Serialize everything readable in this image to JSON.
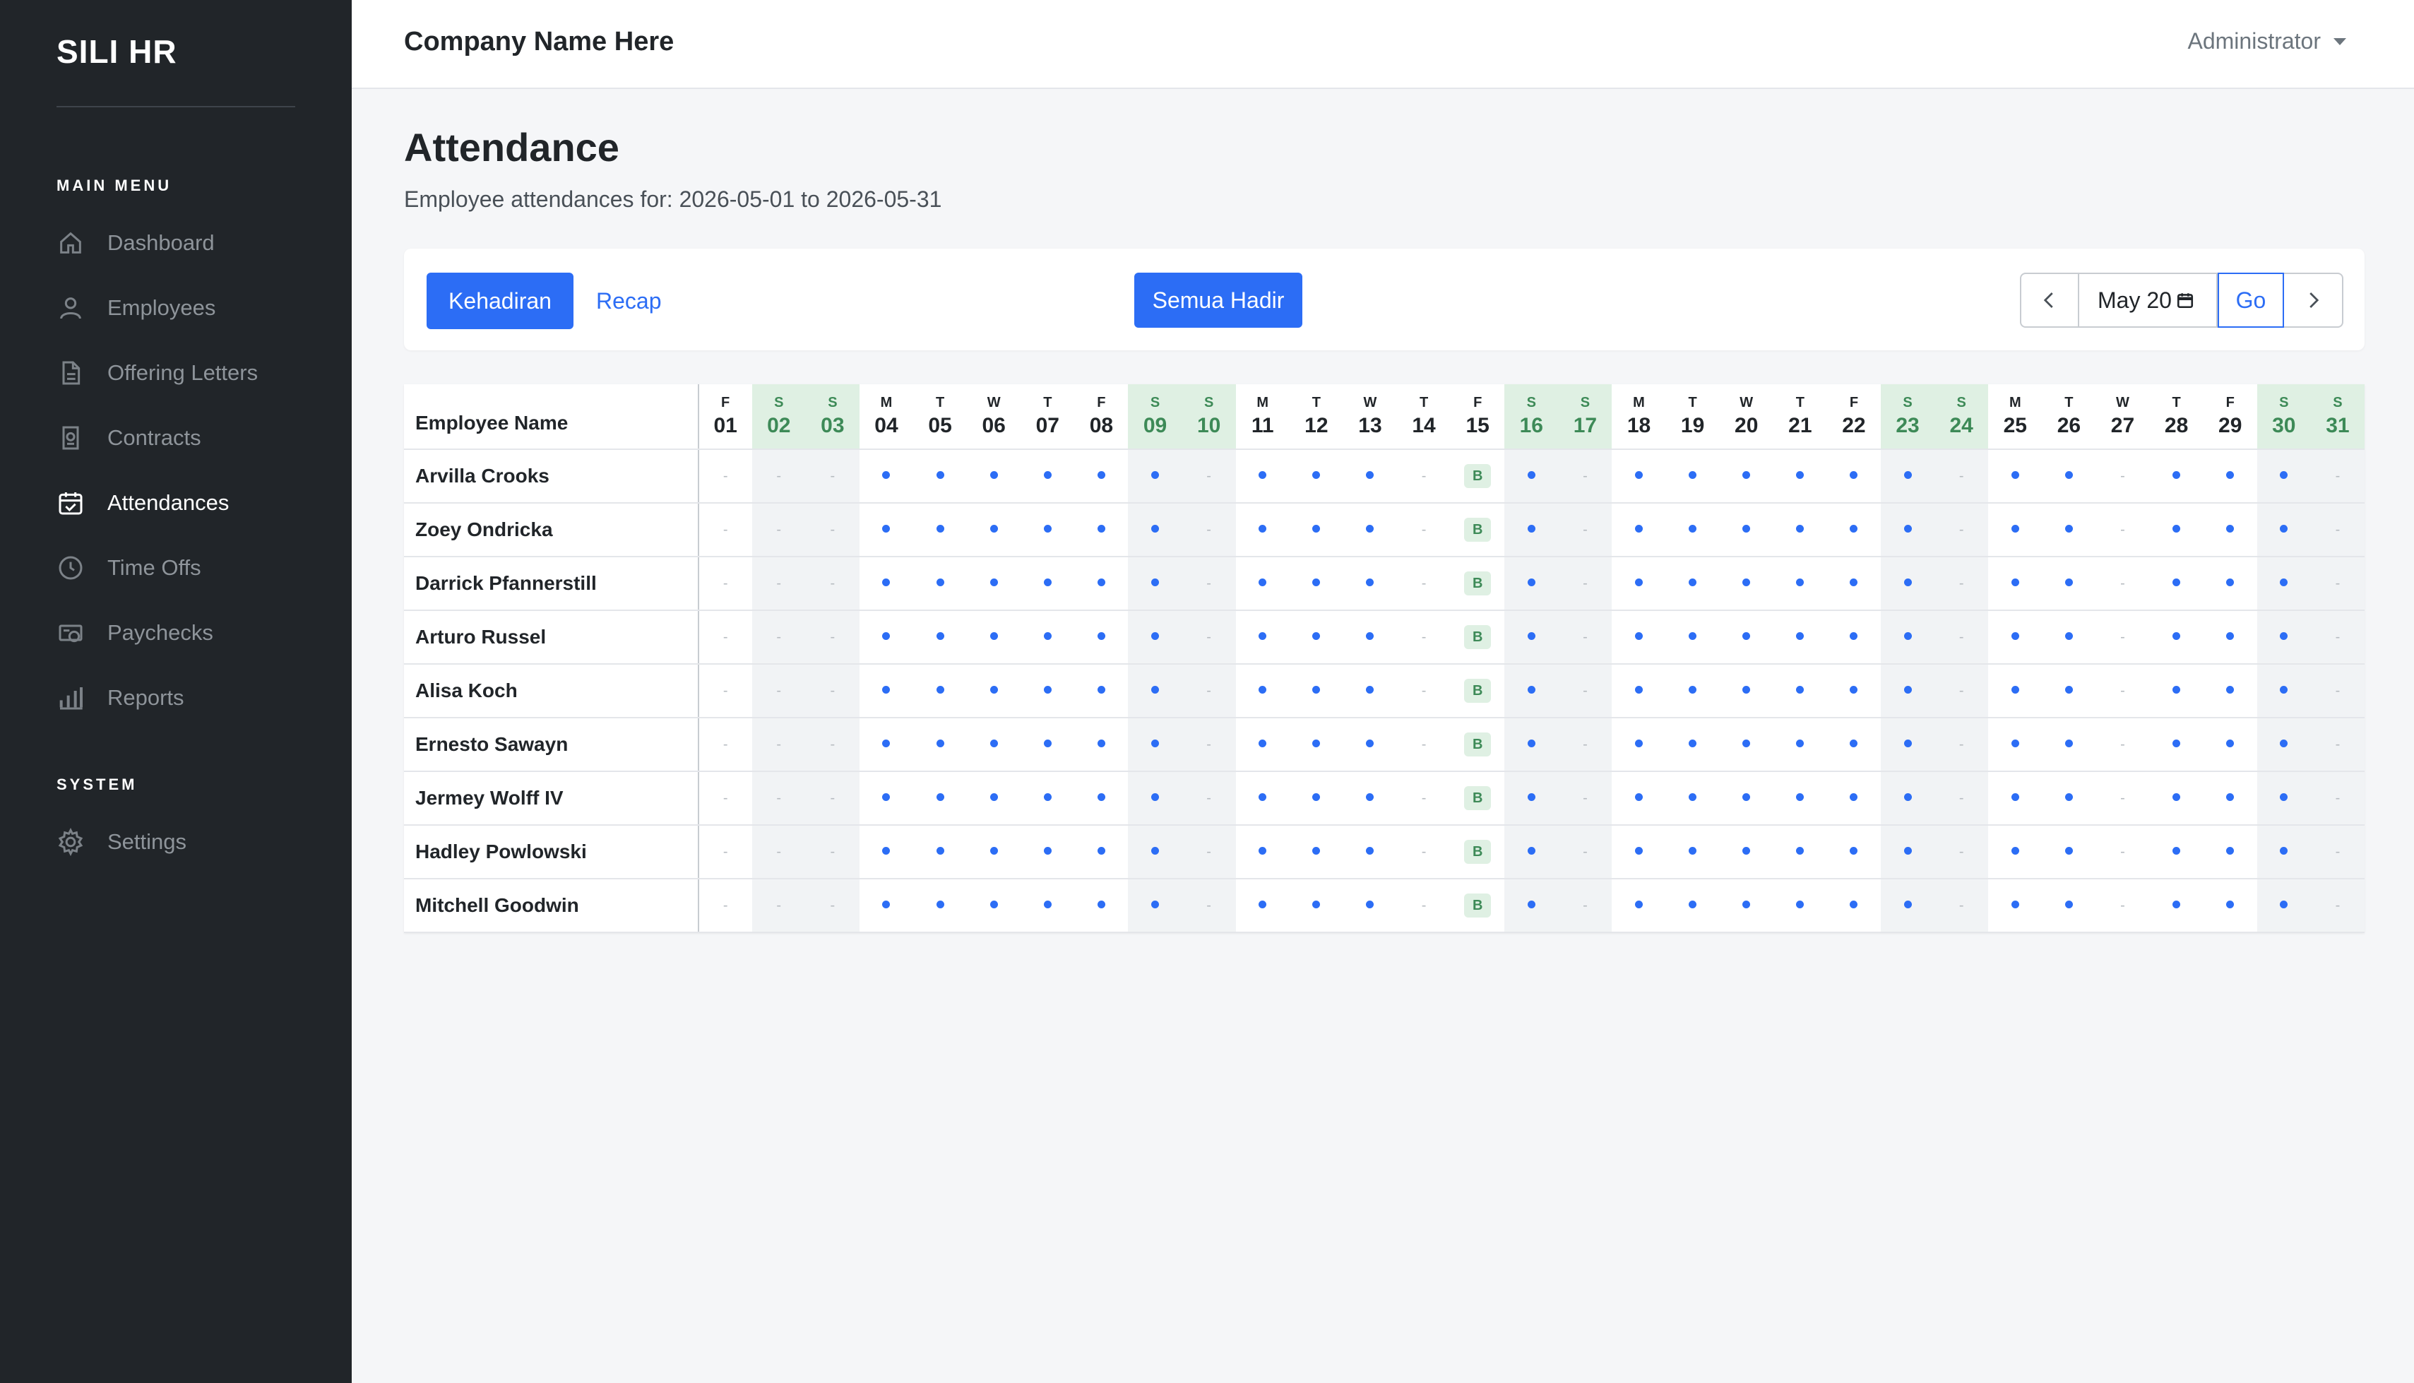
{
  "app": {
    "brand": "SILI HR",
    "company": "Company Name Here",
    "user": "Administrator"
  },
  "sidebar": {
    "main_heading": "MAIN MENU",
    "system_heading": "SYSTEM",
    "items": [
      {
        "label": "Dashboard",
        "icon": "home-icon"
      },
      {
        "label": "Employees",
        "icon": "person-icon"
      },
      {
        "label": "Offering Letters",
        "icon": "document-icon"
      },
      {
        "label": "Contracts",
        "icon": "contract-icon"
      },
      {
        "label": "Attendances",
        "icon": "calendar-check-icon",
        "active": true
      },
      {
        "label": "Time Offs",
        "icon": "clock-icon"
      },
      {
        "label": "Paychecks",
        "icon": "paycheck-icon"
      },
      {
        "label": "Reports",
        "icon": "bar-chart-icon"
      }
    ],
    "system_items": [
      {
        "label": "Settings",
        "icon": "gear-icon"
      }
    ]
  },
  "page": {
    "title": "Attendance",
    "subtitle": "Employee attendances for: 2026-05-01 to 2026-05-31"
  },
  "toolbar": {
    "kehadiran_label": "Kehadiran",
    "recap_label": "Recap",
    "semua_hadir_label": "Semua Hadir",
    "month_value": "May 20",
    "go_label": "Go"
  },
  "table": {
    "employee_header": "Employee Name",
    "days": [
      {
        "dow": "F",
        "num": "01"
      },
      {
        "dow": "S",
        "num": "02"
      },
      {
        "dow": "S",
        "num": "03"
      },
      {
        "dow": "M",
        "num": "04"
      },
      {
        "dow": "T",
        "num": "05"
      },
      {
        "dow": "W",
        "num": "06"
      },
      {
        "dow": "T",
        "num": "07"
      },
      {
        "dow": "F",
        "num": "08"
      },
      {
        "dow": "S",
        "num": "09"
      },
      {
        "dow": "S",
        "num": "10"
      },
      {
        "dow": "M",
        "num": "11"
      },
      {
        "dow": "T",
        "num": "12"
      },
      {
        "dow": "W",
        "num": "13"
      },
      {
        "dow": "T",
        "num": "14"
      },
      {
        "dow": "F",
        "num": "15"
      },
      {
        "dow": "S",
        "num": "16"
      },
      {
        "dow": "S",
        "num": "17"
      },
      {
        "dow": "M",
        "num": "18"
      },
      {
        "dow": "T",
        "num": "19"
      },
      {
        "dow": "W",
        "num": "20"
      },
      {
        "dow": "T",
        "num": "21"
      },
      {
        "dow": "F",
        "num": "22"
      },
      {
        "dow": "S",
        "num": "23"
      },
      {
        "dow": "S",
        "num": "24"
      },
      {
        "dow": "M",
        "num": "25"
      },
      {
        "dow": "T",
        "num": "26"
      },
      {
        "dow": "W",
        "num": "27"
      },
      {
        "dow": "T",
        "num": "28"
      },
      {
        "dow": "F",
        "num": "29"
      },
      {
        "dow": "S",
        "num": "30"
      },
      {
        "dow": "S",
        "num": "31"
      }
    ],
    "attendance": [
      "-",
      "-",
      "-",
      "•",
      "•",
      "•",
      "•",
      "•",
      "•",
      "-",
      "•",
      "•",
      "•",
      "-",
      "B",
      "•",
      "-",
      "•",
      "•",
      "•",
      "•",
      "•",
      "•",
      "-",
      "•",
      "•",
      "-",
      "•",
      "•",
      "•",
      "-"
    ],
    "employees": [
      "Arvilla Crooks",
      "Zoey Ondricka",
      "Darrick Pfannerstill",
      "Arturo Russel",
      "Alisa Koch",
      "Ernesto Sawayn",
      "Jermey Wolff IV",
      "Hadley Powlowski",
      "Mitchell Goodwin"
    ]
  },
  "colors": {
    "sidebar_bg": "#212529",
    "accent": "#2c6df5",
    "weekend_header": "#dff0e3",
    "weekend_text": "#3d8a57"
  }
}
